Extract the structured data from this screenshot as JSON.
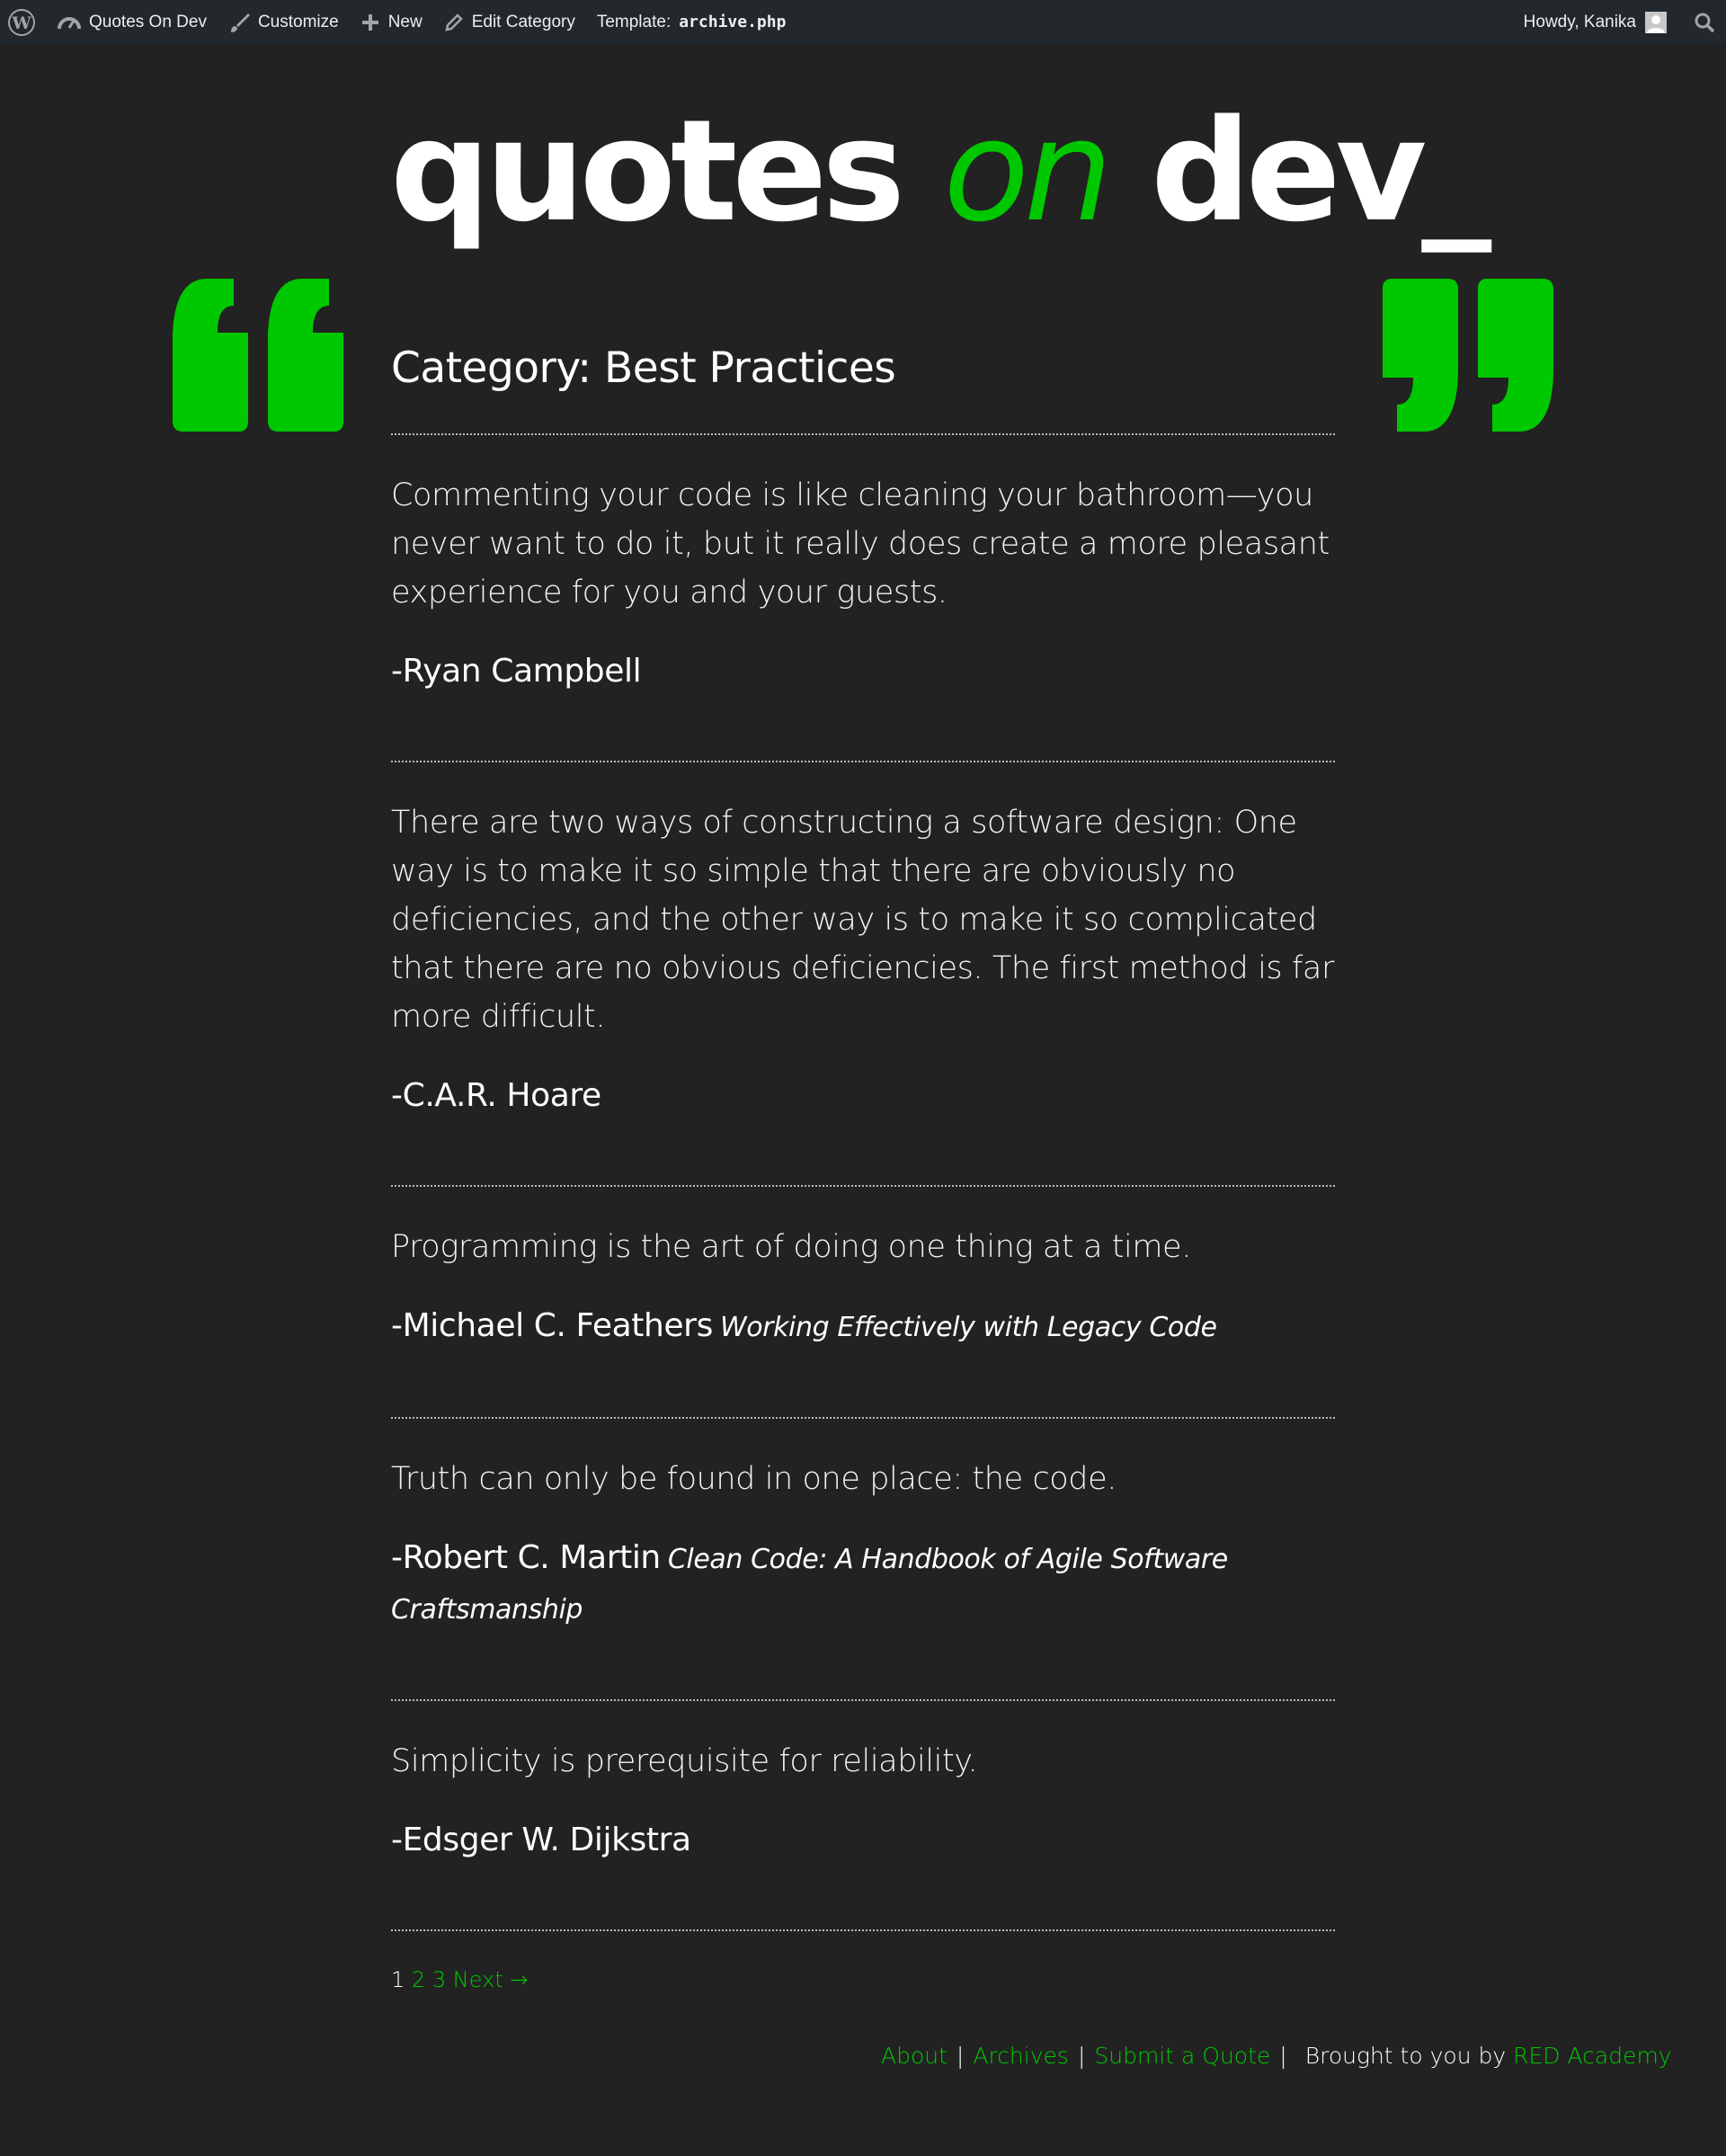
{
  "admin_bar": {
    "site_name": "Quotes On Dev",
    "customize": "Customize",
    "new": "New",
    "edit_category": "Edit Category",
    "template_label": "Template:",
    "template_file": "archive.php",
    "greeting": "Howdy, Kanika"
  },
  "header": {
    "title_part1": "quotes",
    "title_part2": "on",
    "title_part3": "dev_"
  },
  "main": {
    "category_title": "Category: Best Practices",
    "quotes": [
      {
        "text": "Commenting your code is like cleaning your bathroom—you never want to do it, but it really does create a more pleasant experience for you and your guests.",
        "author": "-Ryan Campbell",
        "source": ""
      },
      {
        "text": "There are two ways of constructing a software design: One way is to make it so simple that there are obviously no deficiencies, and the other way is to make it so complicated that there are no obvious deficiencies. The first method is far more difficult.",
        "author": "-C.A.R. Hoare",
        "source": ""
      },
      {
        "text": "Programming is the art of doing one thing at a time.",
        "author": "-Michael C. Feathers",
        "source": "Working Effectively with Legacy Code"
      },
      {
        "text": "Truth can only be found in one place: the code.",
        "author": "-Robert C. Martin",
        "source": "Clean Code: A Handbook of Agile Software Craftsmanship"
      },
      {
        "text": "Simplicity is prerequisite for reliability.",
        "author": "-Edsger W. Dijkstra",
        "source": ""
      }
    ],
    "pagination": {
      "current": "1",
      "page2": "2",
      "page3": "3",
      "next": "Next →"
    }
  },
  "footer": {
    "about": "About",
    "archives": "Archives",
    "submit": "Submit a Quote",
    "sep": "|",
    "brought_by": "Brought to you by",
    "academy": "RED Academy"
  },
  "colors": {
    "background": "#222222",
    "accent": "#00c800",
    "admin_bar": "#23282d"
  },
  "icons": [
    "wordpress-icon",
    "dashboard-icon",
    "brush-icon",
    "plus-icon",
    "pencil-icon",
    "avatar-icon",
    "search-icon",
    "open-quote-icon",
    "close-quote-icon"
  ]
}
